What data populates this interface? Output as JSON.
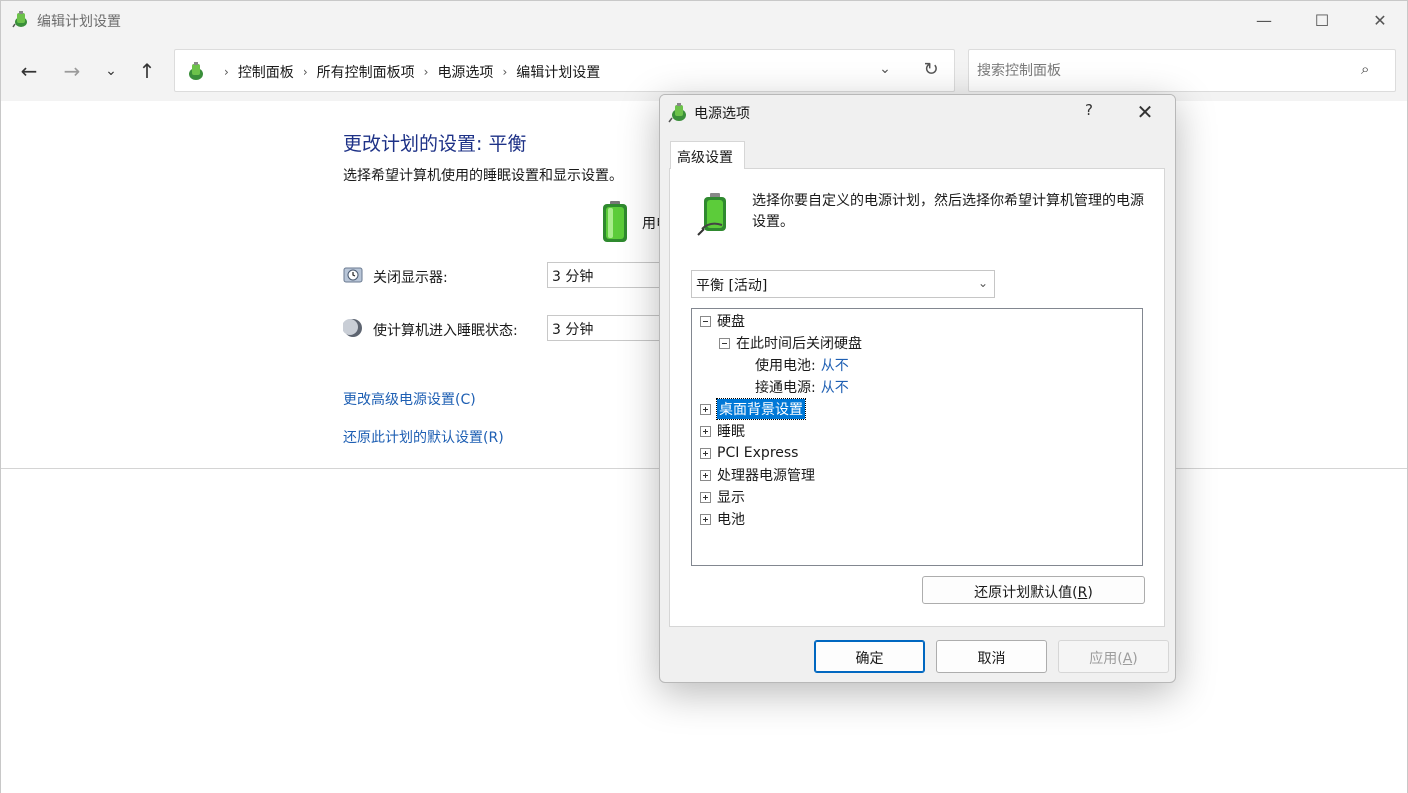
{
  "window": {
    "title": "编辑计划设置",
    "controls": {
      "minimize": "—",
      "maximize": "☐",
      "close": "✕"
    }
  },
  "nav": {
    "back": "←",
    "forward": "→",
    "recent": "⌄",
    "up": "↑",
    "breadcrumbs": [
      "控制面板",
      "所有控制面板项",
      "电源选项",
      "编辑计划设置"
    ],
    "crumb_sep": "›",
    "dropdown": "⌄",
    "refresh": "↻"
  },
  "search": {
    "placeholder": "搜索控制面板",
    "value": "",
    "icon": "⌕"
  },
  "main": {
    "heading": "更改计划的设置: 平衡",
    "subheading": "选择希望计算机使用的睡眠设置和显示设置。",
    "column_label": "用电",
    "rows": [
      {
        "label": "关闭显示器:",
        "value": "3 分钟"
      },
      {
        "label": "使计算机进入睡眠状态:",
        "value": "3 分钟"
      }
    ],
    "links": [
      "更改高级电源设置(C)",
      "还原此计划的默认设置(R)"
    ]
  },
  "dialog": {
    "title": "电源选项",
    "help": "?",
    "close": "✕",
    "tab": "高级设置",
    "description": "选择你要自定义的电源计划，然后选择你希望计算机管理的电源设置。",
    "plan": {
      "selected": "平衡 [活动]",
      "arrow": "⌄"
    },
    "tree": {
      "hard_disk": "硬盘",
      "turn_off_after": "在此时间后关闭硬盘",
      "on_battery_label": "使用电池:",
      "on_battery_value": "从不",
      "plugged_in_label": "接通电源:",
      "plugged_in_value": "从不",
      "desktop_bg": "桌面背景设置",
      "sleep": "睡眠",
      "pci": "PCI Express",
      "cpu": "处理器电源管理",
      "display": "显示",
      "battery": "电池"
    },
    "restore_label": "还原计划默认值(",
    "restore_key": "R",
    "restore_end": ")",
    "ok": "确定",
    "cancel": "取消",
    "apply_label": "应用(",
    "apply_key": "A",
    "apply_end": ")"
  }
}
